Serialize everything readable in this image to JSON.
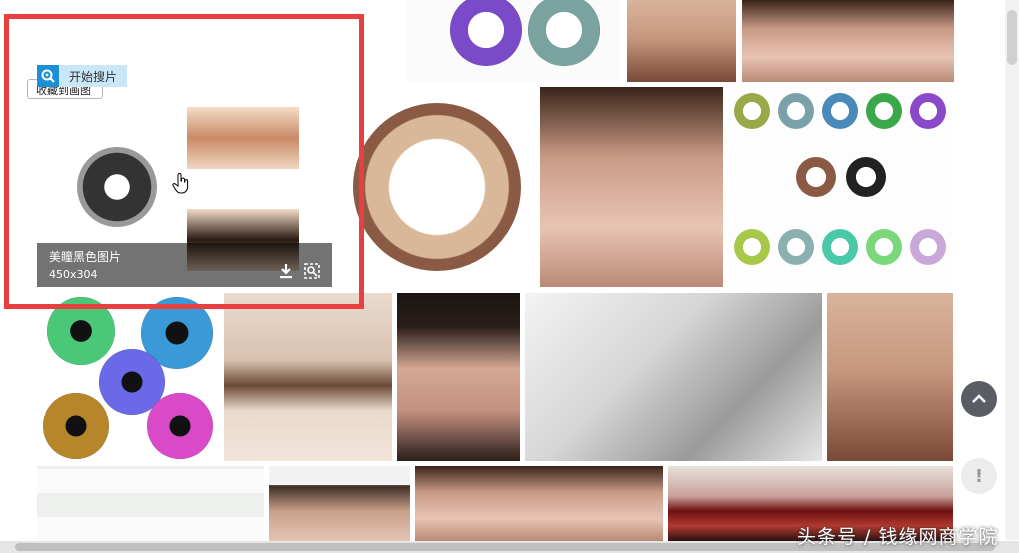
{
  "overlay": {
    "search_label": "开始搜片",
    "collect_label": "收藏到画图",
    "caption_title": "美瞳黑色图片",
    "caption_size": "450x304"
  },
  "watermark": "头条号 / 钱缘网商学院",
  "colors": {
    "highlight_border": "#e84040",
    "accent_blue": "#1a8fd6",
    "button_grey": "#5a5d63"
  },
  "icons": {
    "search": "magnifier-icon",
    "download": "download-icon",
    "similar": "similar-search-icon",
    "back_to_top": "chevron-up-icon",
    "feedback": "exclamation-icon",
    "cursor": "hand-cursor-icon"
  }
}
